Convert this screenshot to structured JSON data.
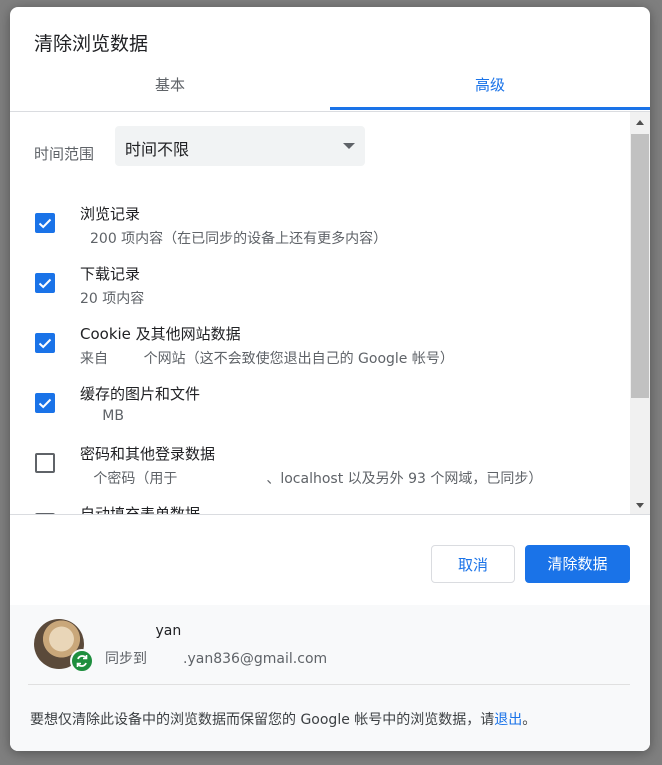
{
  "dialog": {
    "title": "清除浏览数据"
  },
  "tabs": [
    {
      "label": "基本",
      "active": false
    },
    {
      "label": "高级",
      "active": true
    }
  ],
  "time_range": {
    "label": "时间范围",
    "value": "时间不限"
  },
  "items": [
    {
      "title": "浏览记录",
      "subtitle": "200 项内容（在已同步的设备上还有更多内容）",
      "checked": true
    },
    {
      "title": "下载记录",
      "subtitle": "20 项内容",
      "checked": true
    },
    {
      "title": "Cookie 及其他网站数据",
      "subtitle": "来自        个网站（这不会致使您退出自己的 Google 帐号）",
      "checked": true
    },
    {
      "title": "缓存的图片和文件",
      "subtitle": "     MB",
      "checked": true
    },
    {
      "title": "密码和其他登录数据",
      "subtitle": "   个密码（用于                    、localhost 以及另外 93 个网域，已同步）",
      "checked": false
    },
    {
      "title": "自动填充表单数据",
      "subtitle": "",
      "checked": false
    }
  ],
  "buttons": {
    "cancel": "取消",
    "clear": "清除数据"
  },
  "account": {
    "name": "yan",
    "sync_prefix": "同步到",
    "email_suffix": ".yan836@gmail.com"
  },
  "footer": {
    "note": "要想仅清除此设备中的浏览数据而保留您的 Google 帐号中的浏览数据，请",
    "link": "退出",
    "end": "。"
  },
  "colors": {
    "accent": "#1a73e8",
    "sync_green": "#1e8e3e"
  }
}
